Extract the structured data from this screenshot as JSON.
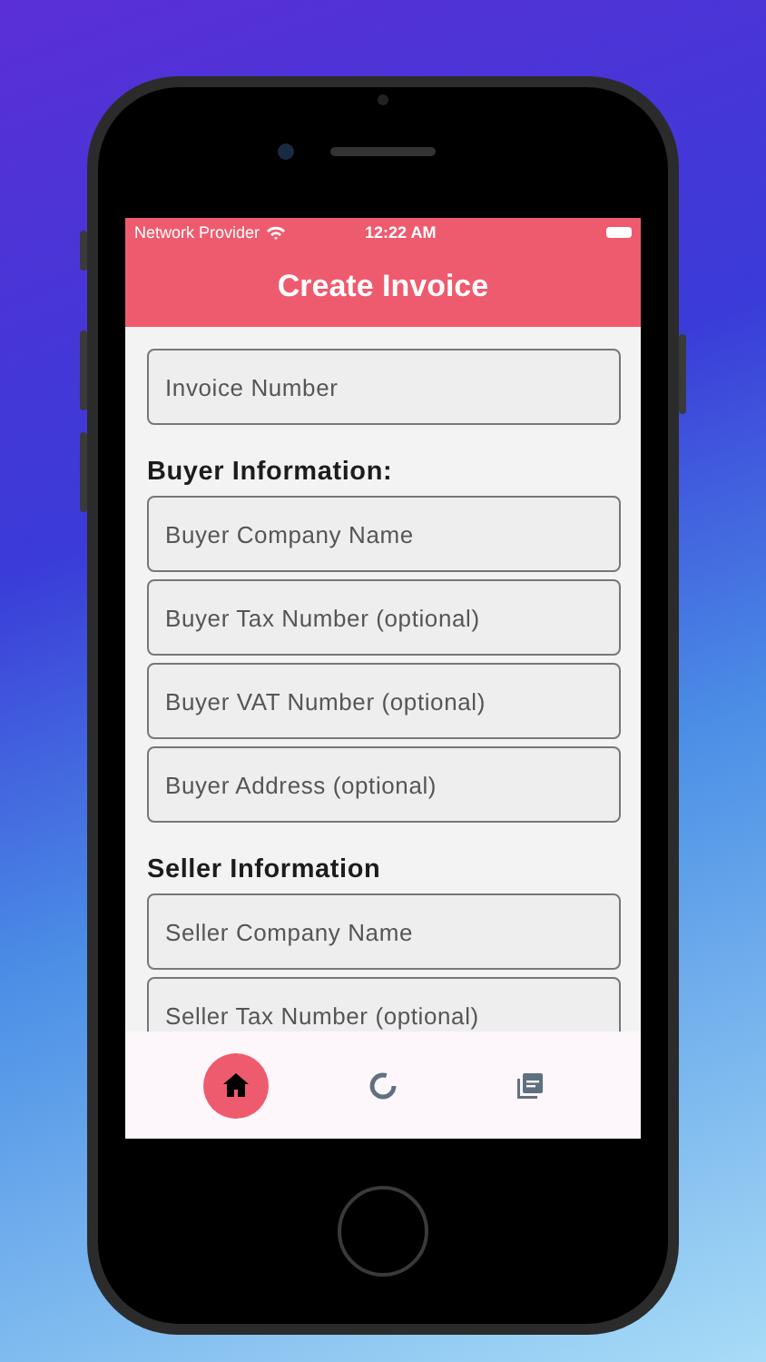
{
  "status_bar": {
    "carrier": "Network Provider",
    "time": "12:22 AM"
  },
  "header": {
    "title": "Create Invoice"
  },
  "form": [
    {
      "kind": "field",
      "placeholder": "Invoice Number"
    },
    {
      "kind": "heading",
      "text": "Buyer Information:"
    },
    {
      "kind": "field",
      "placeholder": "Buyer Company Name"
    },
    {
      "kind": "field",
      "placeholder": "Buyer Tax Number (optional)"
    },
    {
      "kind": "field",
      "placeholder": "Buyer VAT Number (optional)"
    },
    {
      "kind": "field",
      "placeholder": "Buyer Address (optional)"
    },
    {
      "kind": "heading",
      "text": "Seller Information"
    },
    {
      "kind": "field",
      "placeholder": "Seller Company Name"
    },
    {
      "kind": "field",
      "placeholder": "Seller Tax Number (optional)"
    }
  ],
  "bottom_nav": [
    {
      "kind": "home",
      "selected": true
    },
    {
      "kind": "progress",
      "selected": false
    },
    {
      "kind": "pdf",
      "selected": false
    }
  ]
}
